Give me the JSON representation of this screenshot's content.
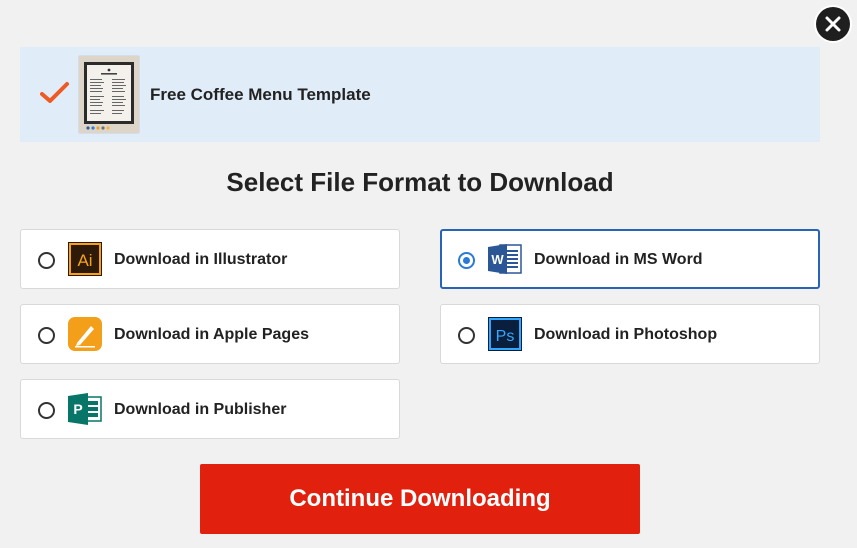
{
  "close_icon": "close-icon",
  "template": {
    "name": "Free Coffee Menu Template",
    "check_icon": "checkmark-icon",
    "thumbnail_title": "The Coffee Menu",
    "check_color": "#ee5a24"
  },
  "section_title": "Select File Format to Download",
  "options": [
    {
      "label": "Download in Illustrator",
      "icon": "illustrator-icon",
      "selected": false
    },
    {
      "label": "Download in MS Word",
      "icon": "ms-word-icon",
      "selected": true
    },
    {
      "label": "Download in Apple Pages",
      "icon": "apple-pages-icon",
      "selected": false
    },
    {
      "label": "Download in Photoshop",
      "icon": "photoshop-icon",
      "selected": false
    },
    {
      "label": "Download in Publisher",
      "icon": "publisher-icon",
      "selected": false
    }
  ],
  "continue_button": {
    "label": "Continue Downloading",
    "color": "#e2200e"
  },
  "colors": {
    "background": "#f1f1f1",
    "banner": "#e1ecf9",
    "selected_border": "#2763b6",
    "radio_selected": "#2b7ad3"
  }
}
